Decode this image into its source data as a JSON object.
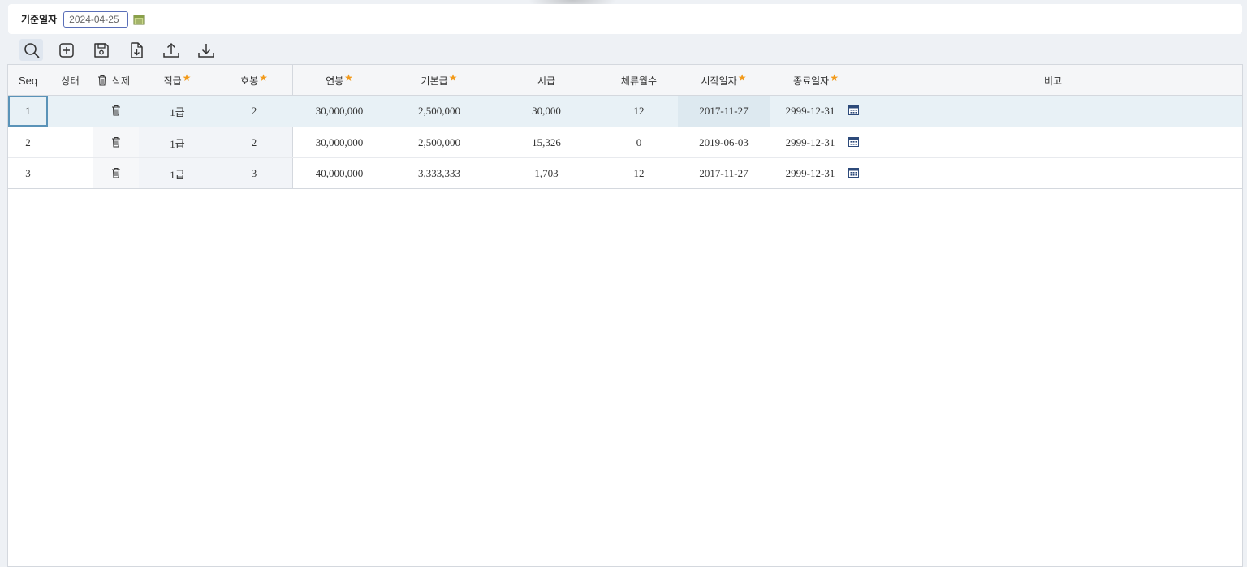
{
  "filter": {
    "label": "기준일자",
    "date_value": "2024-04-25"
  },
  "toolbar": {
    "buttons": [
      "search",
      "add",
      "save",
      "download-file",
      "upload",
      "download"
    ]
  },
  "table": {
    "columns": {
      "seq": "Seq",
      "status": "상태",
      "delete": "삭제",
      "grade": "직급",
      "step": "호봉",
      "annual_salary": "연봉",
      "base_pay": "기본급",
      "hourly_wage": "시급",
      "months": "체류월수",
      "start_date": "시작일자",
      "end_date": "종료일자",
      "note": "비고"
    },
    "rows": [
      {
        "seq": "1",
        "status": "",
        "grade": "1급",
        "step": "2",
        "annual_salary": "30,000,000",
        "base_pay": "2,500,000",
        "hourly_wage": "30,000",
        "months": "12",
        "start_date": "2017-11-27",
        "end_date": "2999-12-31",
        "note": ""
      },
      {
        "seq": "2",
        "status": "",
        "grade": "1급",
        "step": "2",
        "annual_salary": "30,000,000",
        "base_pay": "2,500,000",
        "hourly_wage": "15,326",
        "months": "0",
        "start_date": "2019-06-03",
        "end_date": "2999-12-31",
        "note": ""
      },
      {
        "seq": "3",
        "status": "",
        "grade": "1급",
        "step": "3",
        "annual_salary": "40,000,000",
        "base_pay": "3,333,333",
        "hourly_wage": "1,703",
        "months": "12",
        "start_date": "2017-11-27",
        "end_date": "2999-12-31",
        "note": ""
      }
    ]
  },
  "colors": {
    "required_mark": "#f29a1a",
    "selected_row": "#e8f1f6",
    "focus_border": "#5a93b8"
  }
}
